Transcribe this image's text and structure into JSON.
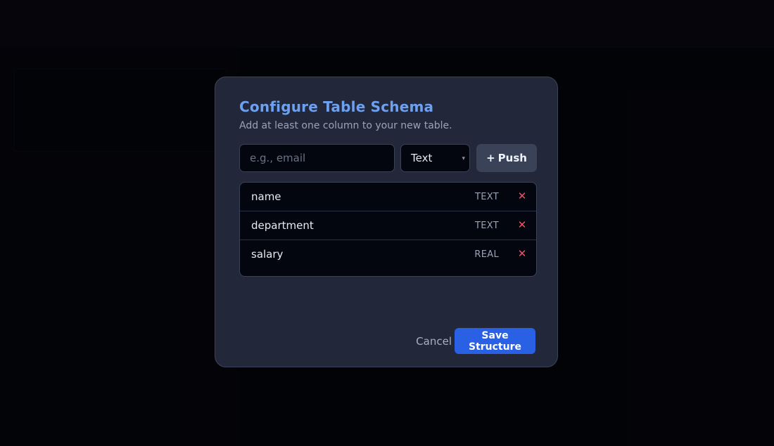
{
  "colors": {
    "accent": "#6ea0f2",
    "primary_button": "#2a60e4",
    "danger": "#ef5368",
    "modal_bg": "#222839"
  },
  "modal": {
    "title": "Configure Table Schema",
    "subtitle": "Add at least one column to your new table."
  },
  "add_column": {
    "input_value": "",
    "input_placeholder": "e.g., email",
    "type_selected": "Text",
    "push_icon": "+",
    "push_label": "Push"
  },
  "columns": [
    {
      "name": "name",
      "type": "TEXT",
      "remove_icon": "✕"
    },
    {
      "name": "department",
      "type": "TEXT",
      "remove_icon": "✕"
    },
    {
      "name": "salary",
      "type": "REAL",
      "remove_icon": "✕"
    }
  ],
  "footer": {
    "cancel_label": "Cancel",
    "save_label": "Save Structure"
  },
  "icons": {
    "select_caret": "▾",
    "remove": "close-icon",
    "add": "plus-icon"
  }
}
